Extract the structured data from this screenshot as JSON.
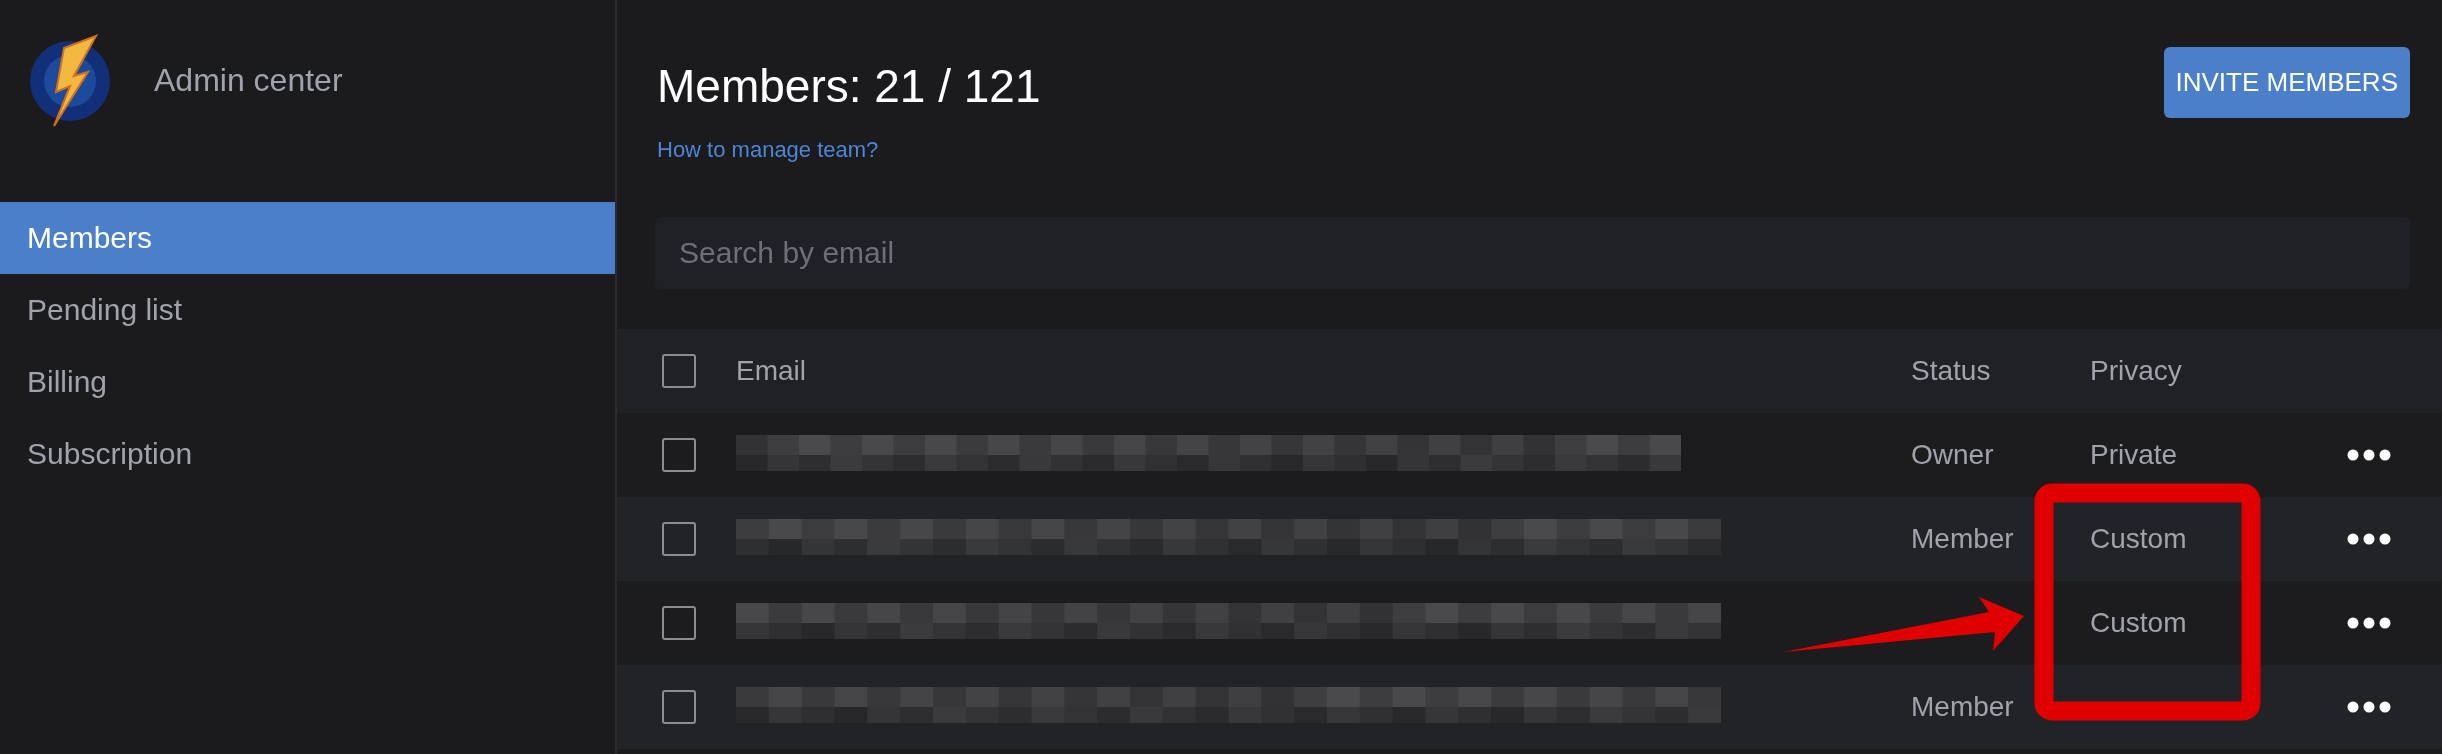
{
  "sidebar": {
    "app_name": "Admin center",
    "items": [
      {
        "label": "Members",
        "selected": true
      },
      {
        "label": "Pending list",
        "selected": false
      },
      {
        "label": "Billing",
        "selected": false
      },
      {
        "label": "Subscription",
        "selected": false
      }
    ]
  },
  "header": {
    "title": "Members: 21 / 121",
    "help_link": "How to manage team?",
    "invite_button": "INVITE MEMBERS"
  },
  "search": {
    "placeholder": "Search by email"
  },
  "table": {
    "columns": [
      "Email",
      "Status",
      "Privacy"
    ],
    "select_all_checked": false,
    "rows": [
      {
        "checked": false,
        "status": "Owner",
        "privacy": "Private"
      },
      {
        "checked": false,
        "status": "Member",
        "privacy": "Custom"
      },
      {
        "checked": false,
        "privacy": "Custom"
      },
      {
        "checked": false,
        "status": "Member"
      }
    ]
  },
  "annotations": {
    "highlight_box": true,
    "arrow": true
  }
}
